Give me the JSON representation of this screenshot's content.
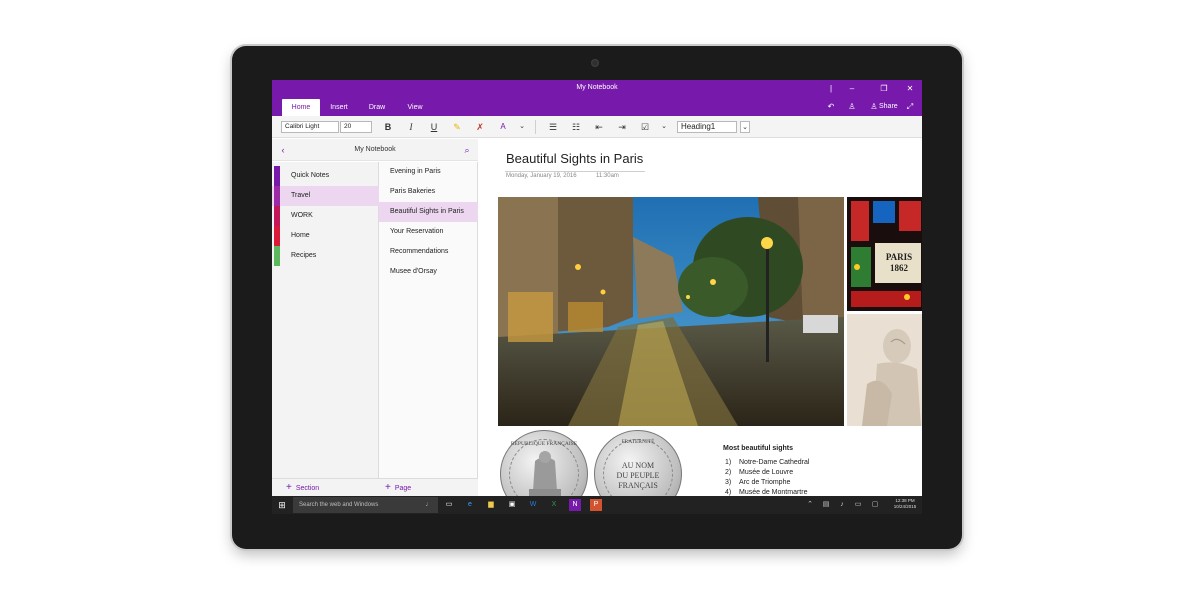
{
  "window": {
    "title": "My Notebook"
  },
  "ribbon": {
    "tabs": [
      "Home",
      "Insert",
      "Draw",
      "View"
    ],
    "share_label": "Share"
  },
  "toolbar": {
    "font_name": "Calibri Light",
    "font_size": "20",
    "bold_label": "B",
    "italic_label": "I",
    "underline_label": "U",
    "style_value": "Heading1"
  },
  "navigation": {
    "notebook_title": "My Notebook",
    "sections": [
      {
        "label": "Quick Notes",
        "color": "#7719aa"
      },
      {
        "label": "Travel",
        "color": "#9c2aa6"
      },
      {
        "label": "WORK",
        "color": "#c2185b"
      },
      {
        "label": "Home",
        "color": "#d81b3b"
      },
      {
        "label": "Recipes",
        "color": "#5cb85c"
      }
    ],
    "selected_section": "Travel",
    "pages": [
      "Evening in Paris",
      "Paris Bakeries",
      "Beautiful Sights in Paris",
      "Your Reservation",
      "Recommendations",
      "Musee d'Orsay"
    ],
    "selected_page": "Beautiful Sights in Paris",
    "add_section_label": "Section",
    "add_page_label": "Page"
  },
  "page": {
    "title": "Beautiful Sights in Paris",
    "date": "Monday, January 19, 2016",
    "time": "11:30am",
    "coin_left_text": "RÉPUBLIQUE FRANÇAISE",
    "coin_right_top": "FRATERNITÉ",
    "coin_right_lines": [
      "AU NOM",
      "DU PEUPLE",
      "FRANÇAIS"
    ],
    "sign_text": "PARIS 1862",
    "list_title": "Most beautiful sights",
    "list_items": [
      {
        "num": "1)",
        "text": "Notre-Dame Cathedral"
      },
      {
        "num": "2)",
        "text": "Musée de Louvre"
      },
      {
        "num": "3)",
        "text": "Arc de Triomphe"
      },
      {
        "num": "4)",
        "text": "Musée de Montmartre"
      }
    ]
  },
  "taskbar": {
    "search_placeholder": "Search the web and Windows",
    "time": "12:38 PM",
    "date": "10/24/2015"
  },
  "colors": {
    "accent": "#7719aa",
    "selection": "#ecd6f0",
    "taskbar": "#222222"
  }
}
